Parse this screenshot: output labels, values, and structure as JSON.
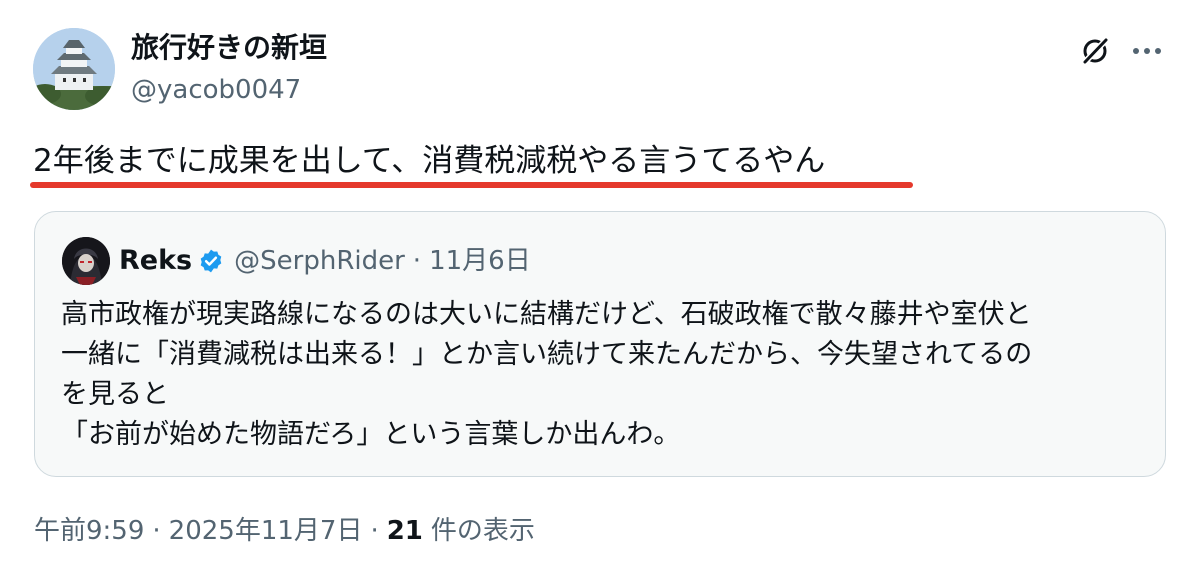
{
  "tweet": {
    "author": {
      "display_name": "旅行好きの新垣",
      "handle": "@yacob0047"
    },
    "text": "2年後までに成果を出して、消費税減税やる言うてるやん",
    "highlight_color": "#e5392c"
  },
  "quote": {
    "author": {
      "display_name": "Reks",
      "handle": "@SerphRider",
      "verified": true
    },
    "separator": "·",
    "date": "11月6日",
    "lines": [
      "高市政権が現実路線になるのは大いに結構だけど、石破政権で散々藤井や室伏と",
      "一緒に「消費減税は出来る！」とか言い続けて来たんだから、今失望されてるの",
      "を見ると",
      "「お前が始めた物語だろ」という言葉しか出んわ。"
    ]
  },
  "meta": {
    "time": "午前9:59",
    "separator": "·",
    "date": "2025年11月7日",
    "views_count": "21",
    "views_label": "件の表示"
  },
  "icons": {
    "grok": "grok-icon",
    "more": "more-dots-icon",
    "verified": "verified-badge-icon"
  },
  "colors": {
    "verified_blue": "#1d9bf0",
    "secondary_text": "#536471",
    "card_border": "#cfd9de"
  }
}
